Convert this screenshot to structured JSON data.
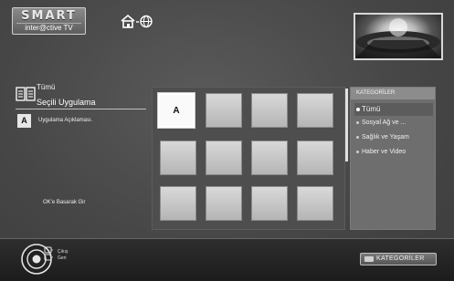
{
  "header": {
    "logo_main": "SMART",
    "logo_sub": "inter@ctive TV",
    "home_icon": "home-globe-icon"
  },
  "left_panel": {
    "all_label": "Tümü",
    "selected_app": "Seçili Uygulama",
    "app_icon_letter": "A",
    "app_description": "Uygulama Açıklaması.",
    "ok_hint": "OK'e Basarak Gir"
  },
  "grid": {
    "selected_tile_letter": "A",
    "rows": 3,
    "cols": 4
  },
  "categories": {
    "header": "KATEGORİLER",
    "items": [
      {
        "label": "Tümü",
        "active": true
      },
      {
        "label": "Sosyal Ağ ve ...",
        "active": false
      },
      {
        "label": "Sağlık ve Yaşam",
        "active": false
      },
      {
        "label": "Haber ve Video",
        "active": false
      }
    ]
  },
  "bottom_bar": {
    "exit_label": "Çıkış",
    "back_label": "Geri",
    "categories_button": "KATEGORİLER",
    "remote_icon": "remote-dpad-icon"
  },
  "colors": {
    "background": "#4a4a4a",
    "tile": "#c8c8c8",
    "panel": "#6e6e6e",
    "bottom_bar": "#1c1c1c"
  }
}
